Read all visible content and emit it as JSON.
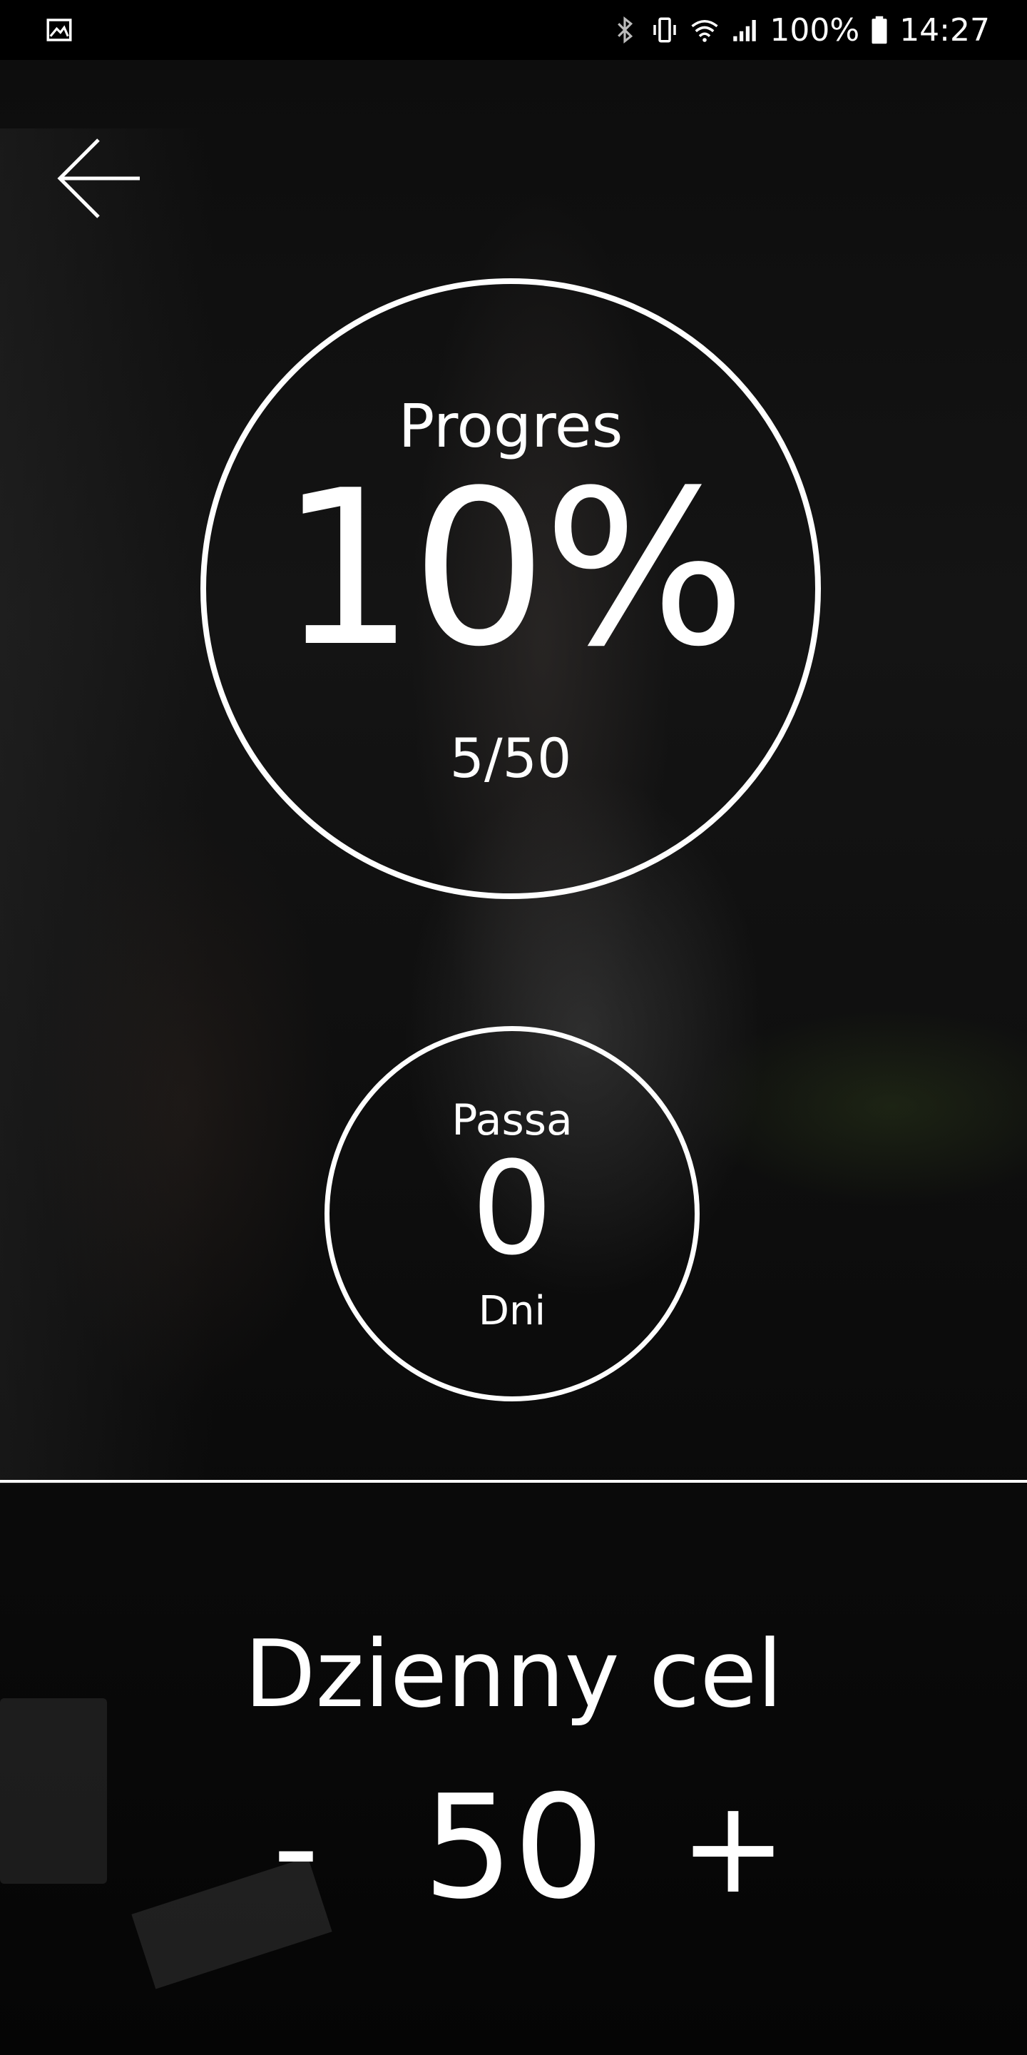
{
  "status_bar": {
    "battery_text": "100%",
    "time": "14:27",
    "icons": [
      "image-icon",
      "bluetooth-icon",
      "vibrate-icon",
      "wifi-icon",
      "signal-icon",
      "battery-icon"
    ]
  },
  "nav": {
    "back_icon": "arrow-left-icon"
  },
  "progress": {
    "title": "Progres",
    "percent_text": "10%",
    "count_text": "5/50"
  },
  "streak": {
    "title": "Passa",
    "value": "0",
    "unit": "Dni"
  },
  "daily_goal": {
    "title": "Dzienny cel",
    "minus_label": "-",
    "value": "50",
    "plus_label": "+"
  },
  "colors": {
    "foreground": "#ffffff",
    "background": "#000000"
  }
}
